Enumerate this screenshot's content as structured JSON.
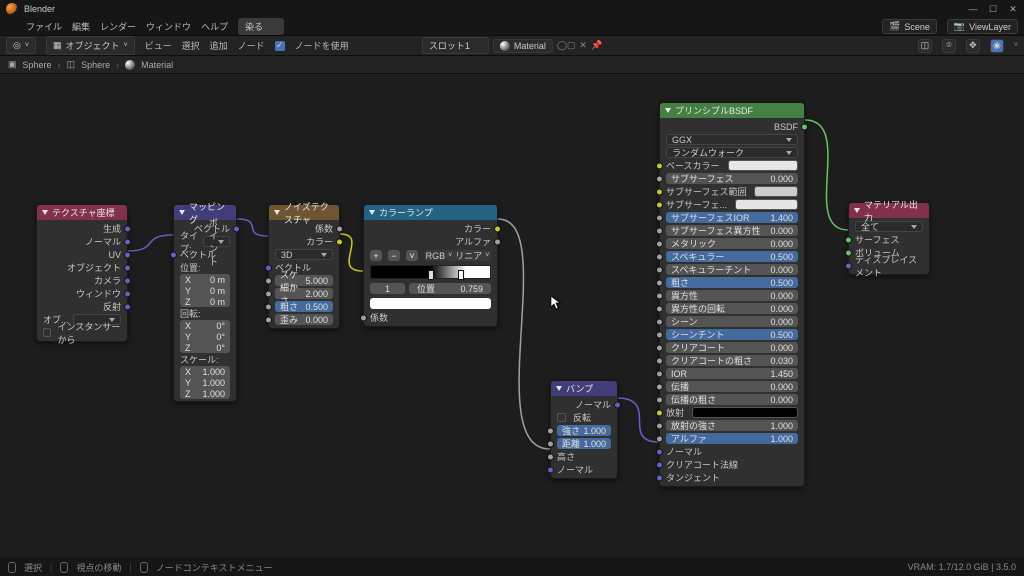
{
  "app_title": "Blender",
  "win": {
    "min": "—",
    "max": "☐",
    "close": "✕"
  },
  "menu": {
    "items": [
      "ファイル",
      "編集",
      "レンダー",
      "ウィンドウ",
      "ヘルプ"
    ],
    "workspace": "染る",
    "scene_icon": "🎬",
    "scene": "Scene",
    "layer_icon": "📷",
    "layer": "ViewLayer"
  },
  "tool": {
    "editor_icon": "◎",
    "obj_btn": "オブジェクト",
    "items": [
      "ビュー",
      "選択",
      "追加",
      "ノード"
    ],
    "use_nodes_chk": "✓",
    "use_nodes": "ノードを使用",
    "slot": "スロット1",
    "mat": "Material",
    "pin": "📌"
  },
  "crumb": [
    "Sphere",
    "Sphere",
    "Material"
  ],
  "status": {
    "l1": "選択",
    "l2": "視点の移動",
    "l3": "ノードコンテキストメニュー",
    "r": "VRAM: 1.7/12.0 GiB | 3.5.0"
  },
  "nodes": {
    "texcoord": {
      "title": "テクスチャ座標",
      "outs": [
        "生成",
        "ノーマル",
        "UV",
        "オブジェクト",
        "カメラ",
        "ウィンドウ",
        "反射"
      ],
      "obj_label": "オブ...",
      "inst": "インスタンサーから"
    },
    "mapping": {
      "title": "マッピング",
      "out": "ベクトル",
      "type_label": "タイプ:",
      "type_val": "ポイント",
      "vec_in": "ベクトル",
      "loc": "位置:",
      "rot": "回転:",
      "scale": "スケール:",
      "xyz": [
        "X",
        "Y",
        "Z"
      ],
      "loc_v": [
        "0 m",
        "0 m",
        "0 m"
      ],
      "rot_v": [
        "0°",
        "0°",
        "0°"
      ],
      "scale_v": [
        "1.000",
        "1.000",
        "1.000"
      ]
    },
    "noise": {
      "title": "ノイズテクスチャ",
      "out_fac": "係数",
      "out_color": "カラー",
      "dim": "3D",
      "vec_in": "ベクトル",
      "f": [
        {
          "l": "スケール",
          "v": "5.000"
        },
        {
          "l": "細かさ",
          "v": "2.000"
        },
        {
          "l": "粗さ",
          "v": "0.500",
          "blue": true
        },
        {
          "l": "歪み",
          "v": "0.000"
        }
      ]
    },
    "ramp": {
      "title": "カラーランプ",
      "out_color": "カラー",
      "out_alpha": "アルファ",
      "plus": "+",
      "minus": "−",
      "menu": "˅",
      "mode1": "RGB",
      "mode2": "リニア",
      "idx": "1",
      "pos_l": "位置",
      "pos_v": "0.759",
      "fac_in": "係数"
    },
    "bump": {
      "title": "バンプ",
      "out": "ノーマル",
      "invert": "反転",
      "f": [
        {
          "l": "強さ",
          "v": "1.000",
          "blue": true
        },
        {
          "l": "距離",
          "v": "1.000",
          "blue": true
        }
      ],
      "ins": [
        "高さ",
        "ノーマル"
      ]
    },
    "bsdf": {
      "title": "プリンシプルBSDF",
      "out": "BSDF",
      "dist": "GGX",
      "sss": "ランダムウォーク",
      "base_lbl": "ベースカラー",
      "rows": [
        {
          "l": "サブサーフェス",
          "v": "0.000"
        },
        {
          "l": "サブサーフェス範囲",
          "sw": "grey"
        },
        {
          "l": "サブサーフェ...",
          "sw": "white"
        },
        {
          "l": "サブサーフェスIOR",
          "v": "1.400",
          "blue": true
        },
        {
          "l": "サブサーフェス異方性",
          "v": "0.000"
        },
        {
          "l": "メタリック",
          "v": "0.000"
        },
        {
          "l": "スペキュラー",
          "v": "0.500",
          "blue": true
        },
        {
          "l": "スペキュラーチント",
          "v": "0.000"
        },
        {
          "l": "粗さ",
          "v": "0.500",
          "blue": true
        },
        {
          "l": "異方性",
          "v": "0.000"
        },
        {
          "l": "異方性の回転",
          "v": "0.000"
        },
        {
          "l": "シーン",
          "v": "0.000"
        },
        {
          "l": "シーンチント",
          "v": "0.500",
          "blue": true
        },
        {
          "l": "クリアコート",
          "v": "0.000"
        },
        {
          "l": "クリアコートの粗さ",
          "v": "0.030"
        },
        {
          "l": "IOR",
          "v": "1.450"
        },
        {
          "l": "伝播",
          "v": "0.000"
        },
        {
          "l": "伝播の粗さ",
          "v": "0.000"
        }
      ],
      "emit_lbl": "放射",
      "emit_str": {
        "l": "放射の強さ",
        "v": "1.000"
      },
      "alpha": {
        "l": "アルファ",
        "v": "1.000",
        "blue": true
      },
      "ins": [
        "ノーマル",
        "クリアコート法線",
        "タンジェント"
      ]
    },
    "output": {
      "title": "マテリアル出力",
      "target": "全て",
      "ins": [
        "サーフェス",
        "ボリューム",
        "ディスプレイスメント"
      ]
    }
  }
}
